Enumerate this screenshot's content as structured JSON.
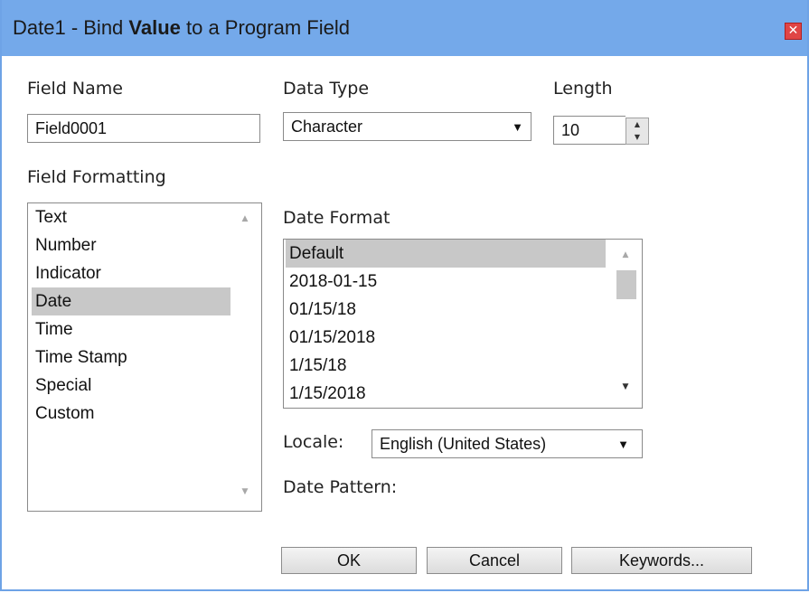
{
  "title": {
    "prefix": "Date1 - Bind ",
    "bold": "Value",
    "suffix": " to a Program Field",
    "close_glyph": "✕"
  },
  "field_name": {
    "label": "Field Name",
    "value": "Field0001"
  },
  "data_type": {
    "label": "Data Type",
    "selected": "Character"
  },
  "length": {
    "label": "Length",
    "value": "10"
  },
  "field_formatting": {
    "label": "Field Formatting",
    "items": [
      "Text",
      "Number",
      "Indicator",
      "Date",
      "Time",
      "Time Stamp",
      "Special",
      "Custom"
    ],
    "selected": "Date"
  },
  "date_format": {
    "label": "Date Format",
    "items": [
      "Default",
      "2018-01-15",
      "01/15/18",
      "01/15/2018",
      "1/15/18",
      "1/15/2018"
    ],
    "selected": "Default"
  },
  "locale": {
    "label": "Locale:",
    "selected": "English (United States)"
  },
  "date_pattern": {
    "label": "Date Pattern:"
  },
  "buttons": {
    "ok": "OK",
    "cancel": "Cancel",
    "keywords": "Keywords..."
  },
  "icons": {
    "dropdown_arrow": "▼",
    "scroll_up": "▲",
    "scroll_down": "▼",
    "spin_up": "▲",
    "spin_down": "▼"
  },
  "colors": {
    "titlebar": "#74a9ea",
    "border": "#6ea3e6",
    "close": "#e04545",
    "selection": "#c8c8c8"
  }
}
